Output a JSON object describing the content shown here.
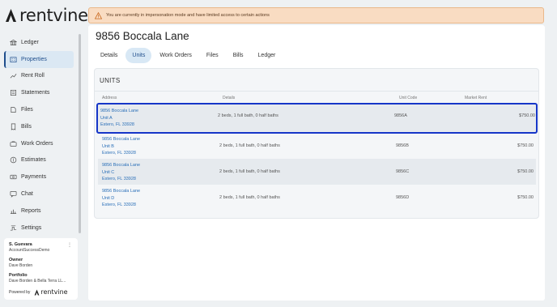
{
  "app": {
    "logo_text": "rentvine"
  },
  "banner": {
    "message": "You are currently in impersonation mode and have limited access to certain actions"
  },
  "sidebar": {
    "items": [
      {
        "label": "Ledger",
        "icon": "bank-icon",
        "active": false
      },
      {
        "label": "Properties",
        "icon": "properties-icon",
        "active": true
      },
      {
        "label": "Rent Roll",
        "icon": "rent-roll-icon",
        "active": false
      },
      {
        "label": "Statements",
        "icon": "statements-icon",
        "active": false
      },
      {
        "label": "Files",
        "icon": "files-icon",
        "active": false
      },
      {
        "label": "Bills",
        "icon": "bills-icon",
        "active": false
      },
      {
        "label": "Work Orders",
        "icon": "work-orders-icon",
        "active": false
      },
      {
        "label": "Estimates",
        "icon": "estimates-icon",
        "active": false
      },
      {
        "label": "Payments",
        "icon": "payments-icon",
        "active": false
      },
      {
        "label": "Chat",
        "icon": "chat-icon",
        "active": false
      },
      {
        "label": "Reports",
        "icon": "reports-icon",
        "active": false
      },
      {
        "label": "Settings",
        "icon": "settings-icon",
        "active": false
      }
    ]
  },
  "user_card": {
    "name": "S. Guevara",
    "account": "AccountSuccessDemo",
    "owner_label": "Owner",
    "owner_value": "Dave Borden",
    "portfolio_label": "Portfolio",
    "portfolio_value": "Dave Borden & Bella Terra LL...",
    "powered_by": "Powered by",
    "powered_logo": "rentvine"
  },
  "page": {
    "title": "9856 Boccala Lane",
    "tabs": [
      "Details",
      "Units",
      "Work Orders",
      "Files",
      "Bills",
      "Ledger"
    ],
    "active_tab": "Units"
  },
  "units": {
    "heading": "UNITS",
    "columns": {
      "address": "Address",
      "details": "Details",
      "unit_code": "Unit Code",
      "market_rent": "Market Rent"
    },
    "rows": [
      {
        "street": "9856 Boccala Lane",
        "unit": "Unit A",
        "city": "Estero, FL 33928",
        "details": "2 beds, 1 full bath, 0 half baths",
        "unit_code": "9856A",
        "market_rent": "$750.00"
      },
      {
        "street": "9856 Boccala Lane",
        "unit": "Unit B",
        "city": "Estero, FL 33928",
        "details": "2 beds, 1 full bath, 0 half baths",
        "unit_code": "9856B",
        "market_rent": "$750.00"
      },
      {
        "street": "9856 Boccala Lane",
        "unit": "Unit C",
        "city": "Estero, FL 33928",
        "details": "2 beds, 1 full bath, 0 half baths",
        "unit_code": "9856C",
        "market_rent": "$750.00"
      },
      {
        "street": "9856 Boccala Lane",
        "unit": "Unit D",
        "city": "Estero, FL 33928",
        "details": "2 beds, 1 full bath, 0 half baths",
        "unit_code": "9856D",
        "market_rent": "$750.00"
      }
    ]
  },
  "colors": {
    "accent": "#1f4e8c",
    "link": "#2a6fb8",
    "selection": "#1636c8",
    "banner_bg": "#f9dcc2"
  }
}
